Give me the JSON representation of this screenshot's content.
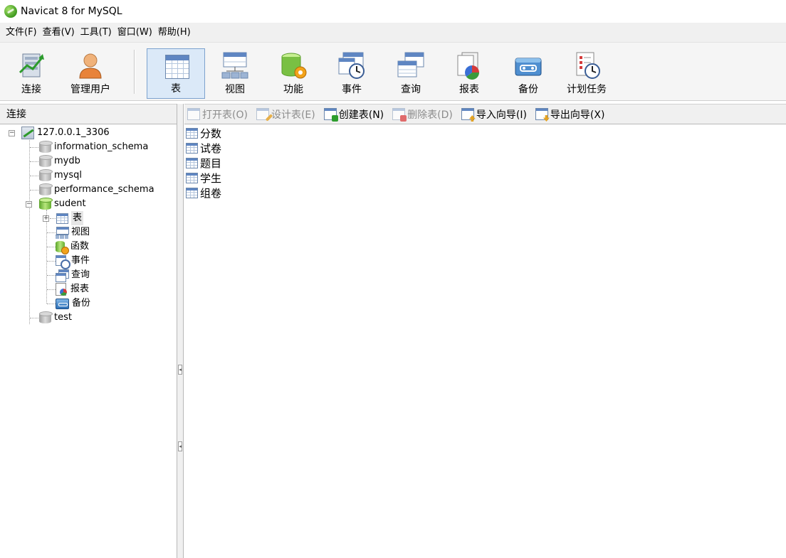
{
  "window": {
    "title": "Navicat 8 for MySQL"
  },
  "menu": [
    "文件(F)",
    "查看(V)",
    "工具(T)",
    "窗口(W)",
    "帮助(H)"
  ],
  "toolbar": {
    "buttons": [
      {
        "label": "连接",
        "icon": "connection-icon"
      },
      {
        "label": "管理用户",
        "icon": "user-icon"
      },
      {
        "label": "表",
        "icon": "table-icon",
        "active": true
      },
      {
        "label": "视图",
        "icon": "view-icon"
      },
      {
        "label": "功能",
        "icon": "function-icon"
      },
      {
        "label": "事件",
        "icon": "event-icon"
      },
      {
        "label": "查询",
        "icon": "query-icon"
      },
      {
        "label": "报表",
        "icon": "report-icon"
      },
      {
        "label": "备份",
        "icon": "backup-icon"
      },
      {
        "label": "计划任务",
        "icon": "schedule-icon"
      }
    ]
  },
  "left_panel": {
    "header": "连接",
    "tree": {
      "connection": "127.0.0.1_3306",
      "databases": [
        "information_schema",
        "mydb",
        "mysql",
        "performance_schema",
        "sudent",
        "test"
      ],
      "open_database": "sudent",
      "open_children": [
        "表",
        "视图",
        "函数",
        "事件",
        "查询",
        "报表",
        "备份"
      ]
    }
  },
  "right_panel": {
    "actions": [
      {
        "label": "打开表(O)",
        "enabled": false
      },
      {
        "label": "设计表(E)",
        "enabled": false
      },
      {
        "label": "创建表(N)",
        "enabled": true
      },
      {
        "label": "删除表(D)",
        "enabled": false
      },
      {
        "label": "导入向导(I)",
        "enabled": true
      },
      {
        "label": "导出向导(X)",
        "enabled": true
      }
    ],
    "tables": [
      "分数",
      "试卷",
      "题目",
      "学生",
      "组卷"
    ]
  }
}
